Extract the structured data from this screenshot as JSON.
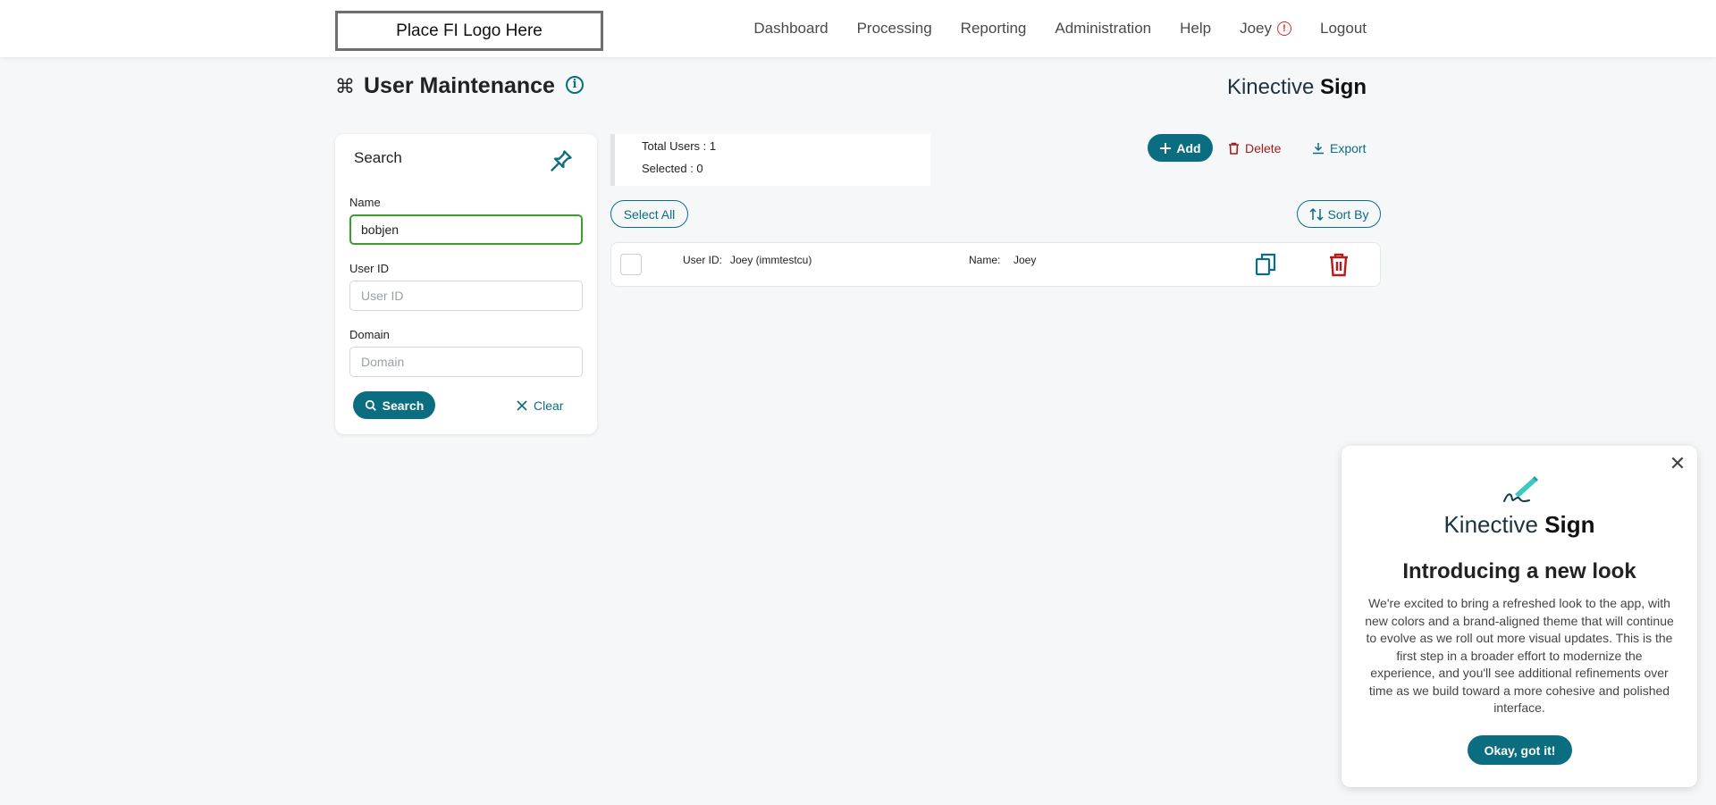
{
  "header": {
    "logo_text": "Place FI Logo Here",
    "nav": [
      "Dashboard",
      "Processing",
      "Reporting",
      "Administration",
      "Help",
      "Joey",
      "Logout"
    ]
  },
  "page": {
    "title": "User Maintenance",
    "brand_light": "Kinective",
    "brand_bold": "Sign"
  },
  "search": {
    "title": "Search",
    "name_label": "Name",
    "name_value": "bobjen",
    "userid_label": "User ID",
    "userid_placeholder": "User ID",
    "domain_label": "Domain",
    "domain_placeholder": "Domain",
    "search_button": "Search",
    "clear_button": "Clear"
  },
  "summary": {
    "total_users": "Total Users : 1",
    "selected": "Selected : 0"
  },
  "actions": {
    "add": "Add",
    "delete": "Delete",
    "export": "Export",
    "select_all": "Select All",
    "sort_by": "Sort By"
  },
  "users": [
    {
      "user_id_label": "User ID:",
      "user_id": "Joey (immtestcu)",
      "name_label": "Name:",
      "name": "Joey"
    }
  ],
  "modal": {
    "brand_light": "Kinective",
    "brand_bold": "Sign",
    "heading": "Introducing a new look",
    "body": "We're excited to bring a refreshed look to the app, with new colors and a brand-aligned theme that will continue to evolve as we roll out more visual updates. This is the first step in a broader effort to modernize the experience, and you'll see additional refinements over time as we build toward a more cohesive and polished interface.",
    "button": "Okay, got it!"
  },
  "colors": {
    "primary": "#0b6e80",
    "danger": "#a31c1c",
    "alert": "#d9262b",
    "focus_border": "#3a9d2e"
  }
}
